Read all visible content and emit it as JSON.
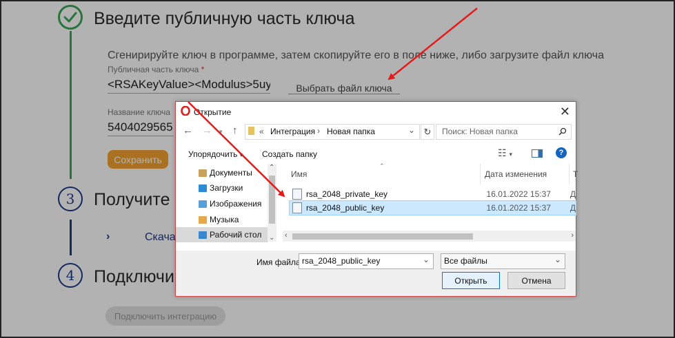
{
  "page": {
    "step2": {
      "title": "Введите публичную часть ключа"
    },
    "hint": "Сгенирируйте ключ в программе, затем скопируйте его в поле ниже, либо загрузите файл ключа",
    "public_key_label": "Публичная часть ключа",
    "required_mark": "*",
    "public_key_value": "<RSAKeyValue><Modulus>5uy",
    "choose_file_link": "Выбрать файл ключа",
    "key_name_label": "Название ключа",
    "key_name_value": "5404029565",
    "save_button": "Сохранить",
    "step3": {
      "number": "3",
      "title": "Получите"
    },
    "download_text": "Скачать",
    "step4": {
      "number": "4",
      "title": "Подключи"
    },
    "connect_button": "Подключить интеграцию"
  },
  "dialog": {
    "title": "Открытие",
    "breadcrumb": {
      "prefix": "«",
      "parts": [
        "Интеграция",
        "Новая папка"
      ]
    },
    "search_placeholder": "Поиск: Новая папка",
    "toolbar": {
      "organize": "Упорядочить",
      "new_folder": "Создать папку"
    },
    "nav_items": [
      {
        "label": "Документы",
        "color": "#c8a25a"
      },
      {
        "label": "Загрузки",
        "color": "#2e8bd6"
      },
      {
        "label": "Изображения",
        "color": "#5aa0d8"
      },
      {
        "label": "Музыка",
        "color": "#e3a94b"
      },
      {
        "label": "Рабочий стол",
        "color": "#3a86d0"
      }
    ],
    "columns": {
      "name": "Имя",
      "date": "Дата изменения",
      "extra": "Т"
    },
    "files": [
      {
        "name": "rsa_2048_private_key",
        "date": "16.01.2022 15:37",
        "extra": "Д",
        "selected": false
      },
      {
        "name": "rsa_2048_public_key",
        "date": "16.01.2022 15:37",
        "extra": "Д",
        "selected": true
      }
    ],
    "filename_label": "Имя файла:",
    "filename_value": "rsa_2048_public_key",
    "filetype_value": "Все файлы",
    "open_button": "Открыть",
    "cancel_button": "Отмена"
  },
  "colors": {
    "accent_green": "#3aa655",
    "accent_blue": "#1e3a8a",
    "save_orange": "#f2a230",
    "arrow_red": "#e31b1b",
    "selection": "#cce8ff"
  }
}
